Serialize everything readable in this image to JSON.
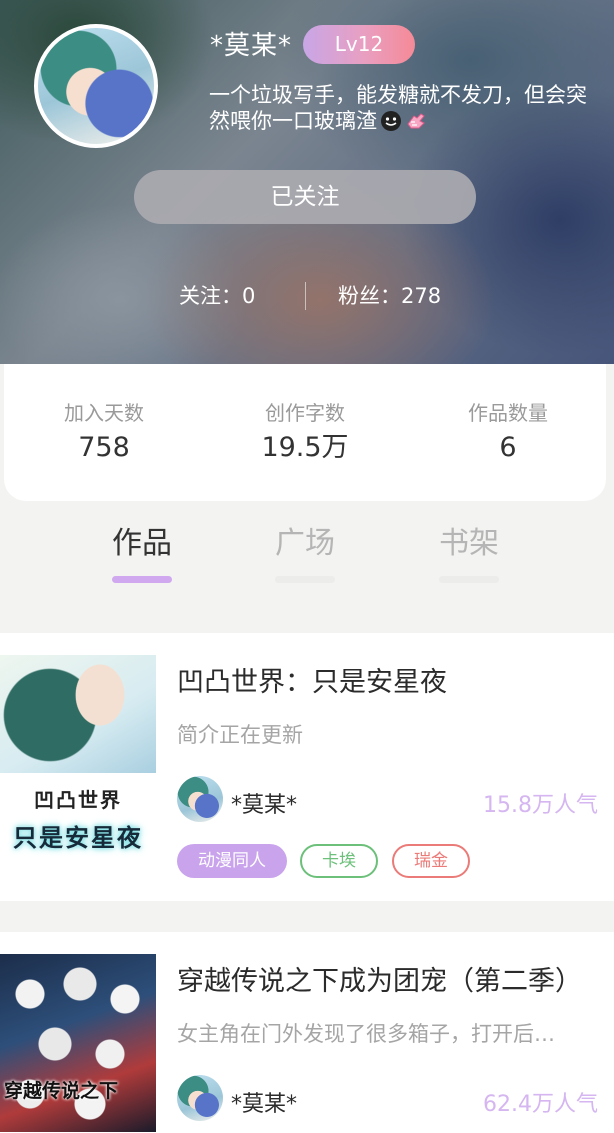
{
  "profile": {
    "username": "*莫某*",
    "level": "Lv12",
    "bio": "一个垃圾写手，能发糖就不发刀，但会突然喂你一口玻璃渣",
    "follow_button": "已关注",
    "following_label": "关注：",
    "following_count": "0",
    "fans_label": "粉丝：",
    "fans_count": "278"
  },
  "stats": [
    {
      "label": "加入天数",
      "value": "758"
    },
    {
      "label": "创作字数",
      "value": "19.5万"
    },
    {
      "label": "作品数量",
      "value": "6"
    }
  ],
  "tabs": [
    {
      "label": "作品",
      "active": true
    },
    {
      "label": "广场",
      "active": false
    },
    {
      "label": "书架",
      "active": false
    }
  ],
  "colors": {
    "accent": "#cfa8ef",
    "tab_active": "#333333",
    "tab_inactive": "#b5b5b5",
    "popularity": "#d5b6f0"
  },
  "works": [
    {
      "title": "凹凸世界：只是安星夜",
      "description": "简介正在更新",
      "author": "*莫某*",
      "popularity": "15.8万人气",
      "cover_text_top": "凹凸世界",
      "cover_text_bottom": "只是安星夜",
      "tags": [
        {
          "label": "动漫同人",
          "style": "filled",
          "color": "#c9a3ec"
        },
        {
          "label": "卡埃",
          "style": "outline",
          "color": "#6cc07a"
        },
        {
          "label": "瑞金",
          "style": "outline",
          "color": "#ea7b78"
        }
      ]
    },
    {
      "title": "穿越传说之下成为团宠（第二季）",
      "description": "女主角在门外发现了很多箱子，打开后…",
      "author": "*莫某*",
      "popularity": "62.4万人气",
      "cover_text": "穿越传说之下"
    }
  ]
}
